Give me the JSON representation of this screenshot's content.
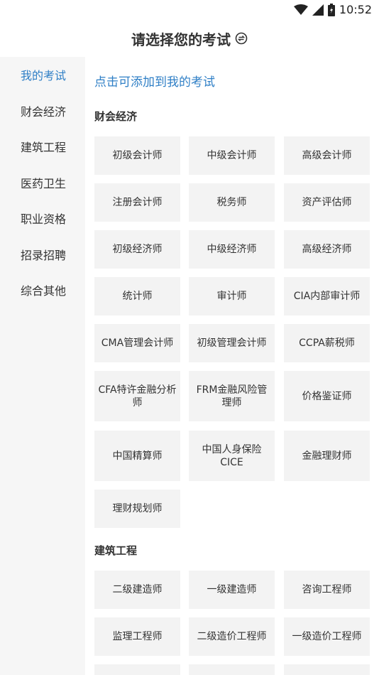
{
  "status": {
    "time": "10:52"
  },
  "header": {
    "title": "请选择您的考试"
  },
  "sidebar": {
    "items": [
      {
        "label": "我的考试",
        "active": true
      },
      {
        "label": "财会经济",
        "active": false
      },
      {
        "label": "建筑工程",
        "active": false
      },
      {
        "label": "医药卫生",
        "active": false
      },
      {
        "label": "职业资格",
        "active": false
      },
      {
        "label": "招录招聘",
        "active": false
      },
      {
        "label": "综合其他",
        "active": false
      }
    ]
  },
  "main": {
    "hint": "点击可添加到我的考试",
    "sections": [
      {
        "title": "财会经济",
        "items": [
          "初级会计师",
          "中级会计师",
          "高级会计师",
          "注册会计师",
          "税务师",
          "资产评估师",
          "初级经济师",
          "中级经济师",
          "高级经济师",
          "统计师",
          "审计师",
          "CIA内部审计师",
          "CMA管理会计师",
          "初级管理会计师",
          "CCPA薪税师",
          "CFA特许金融分析师",
          "FRM金融风险管理师",
          "价格鉴证师",
          "中国精算师",
          "中国人身保险CICE",
          "金融理财师",
          "理财规划师"
        ]
      },
      {
        "title": "建筑工程",
        "items": [
          "二级建造师",
          "一级建造师",
          "咨询工程师",
          "监理工程师",
          "二级造价工程师",
          "一级造价工程师"
        ]
      }
    ]
  },
  "colors": {
    "accent": "#2f7fc6",
    "tile_bg": "#f3f3f3",
    "sidebar_bg": "#f6f6f6"
  }
}
